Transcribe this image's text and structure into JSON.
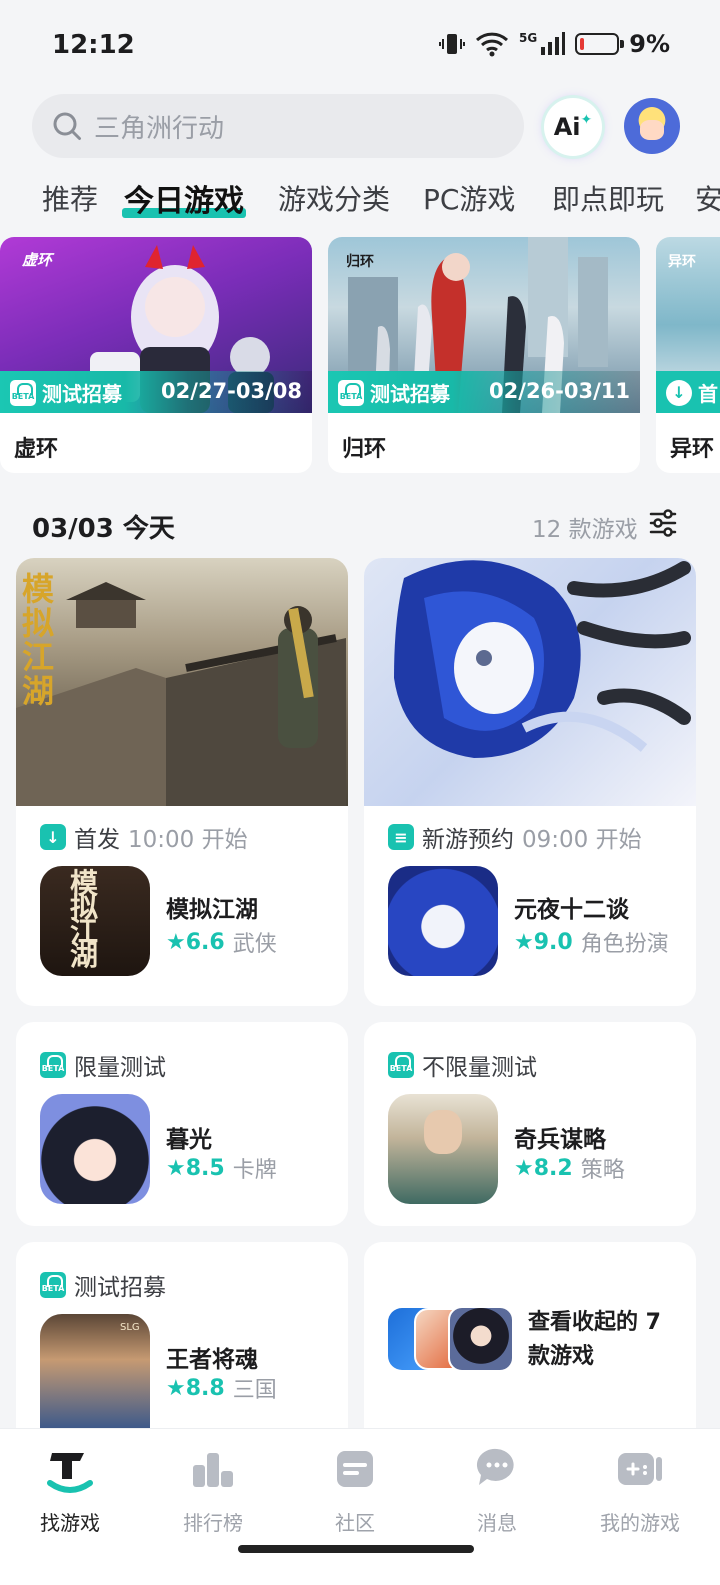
{
  "status": {
    "time": "12:12",
    "network": "5G",
    "battery": "9%"
  },
  "search": {
    "placeholder": "三角洲行动",
    "ai_label": "Ai"
  },
  "tabs": [
    {
      "label": "推荐"
    },
    {
      "label": "今日游戏",
      "active": true
    },
    {
      "label": "游戏分类"
    },
    {
      "label": "PC游戏"
    },
    {
      "label": "即点即玩"
    },
    {
      "label": "安"
    }
  ],
  "banners": [
    {
      "tag": "测试招募",
      "date": "02/27-03/08",
      "name": "虚环",
      "logo": "虚环"
    },
    {
      "tag": "测试招募",
      "date": "02/26-03/11",
      "name": "归环",
      "logo": "归环"
    },
    {
      "tag": "首",
      "date": "",
      "name": "异环",
      "logo": "异环"
    }
  ],
  "section": {
    "title": "03/03 今天",
    "count": "12 款游戏"
  },
  "cards": [
    {
      "kind": "首发",
      "time": "10:00 开始",
      "name": "模拟江湖",
      "score": "6.6",
      "genre": "武侠",
      "calligraphy": "模拟江湖"
    },
    {
      "kind": "新游预约",
      "time": "09:00 开始",
      "name": "元夜十二谈",
      "score": "9.0",
      "genre": "角色扮演"
    },
    {
      "kind": "限量测试",
      "name": "暮光",
      "score": "8.5",
      "genre": "卡牌"
    },
    {
      "kind": "不限量测试",
      "name": "奇兵谋略",
      "score": "8.2",
      "genre": "策略"
    },
    {
      "kind": "测试招募",
      "name": "王者将魂",
      "score": "8.8",
      "genre": "三国",
      "icon_text": "SLG"
    }
  ],
  "collapsed": {
    "text": "查看收起的 7 款游戏"
  },
  "bottom_nav": [
    {
      "label": "找游戏",
      "active": true
    },
    {
      "label": "排行榜"
    },
    {
      "label": "社区"
    },
    {
      "label": "消息"
    },
    {
      "label": "我的游戏"
    }
  ],
  "colors": {
    "accent": "#19c2b0",
    "text": "#1d1d1f",
    "muted": "#9a9ea6",
    "bg": "#f4f5f7"
  }
}
